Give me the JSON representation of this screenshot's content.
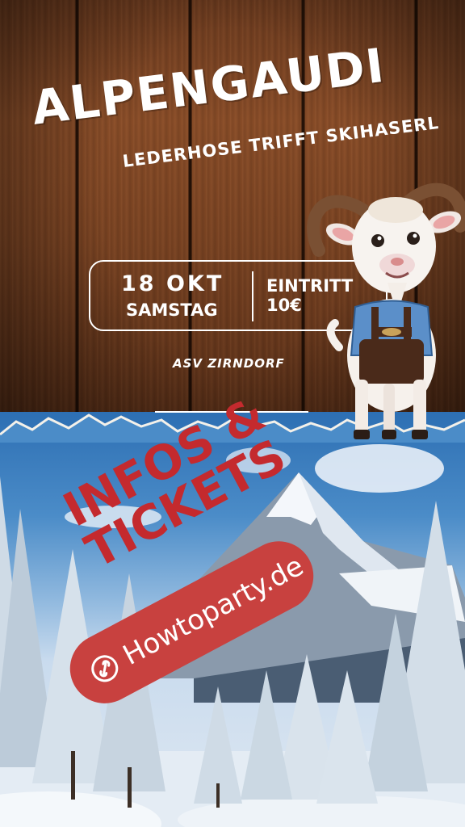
{
  "title": "ALPENGAUDI",
  "subtitle": "LEDERHOSE TRIFFT SKIHASERL",
  "event": {
    "date": "18  OKT",
    "day": "SAMSTAG",
    "entry_label": "EINTRITT",
    "entry_price": "10€",
    "venue": "ASV ZIRNDORF"
  },
  "cta": {
    "line1": "INFOS &",
    "line2": "TICKETS",
    "link_label": "Howtoparty.de",
    "link_icon": "link-icon"
  },
  "colors": {
    "accent_red": "#c8413f",
    "text_white": "#ffffff",
    "wood": "#7a4322"
  },
  "mascot": "goat-in-lederhosen"
}
